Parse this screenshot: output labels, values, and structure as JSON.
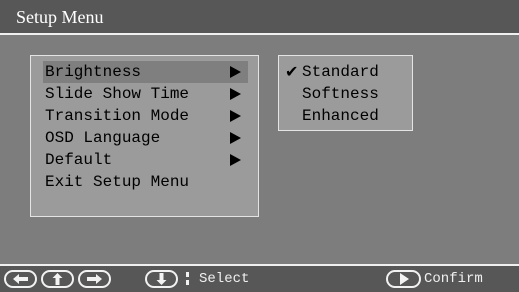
{
  "title": "Setup Menu",
  "menu": {
    "items": [
      {
        "label": "Brightness",
        "has_submenu": true,
        "selected": true
      },
      {
        "label": "Slide Show Time",
        "has_submenu": true,
        "selected": false
      },
      {
        "label": "Transition Mode",
        "has_submenu": true,
        "selected": false
      },
      {
        "label": "OSD Language",
        "has_submenu": true,
        "selected": false
      },
      {
        "label": "Default",
        "has_submenu": true,
        "selected": false
      },
      {
        "label": "Exit Setup Menu",
        "has_submenu": false,
        "selected": false
      }
    ]
  },
  "submenu": {
    "items": [
      {
        "label": "Standard",
        "checked": true
      },
      {
        "label": "Softness",
        "checked": false
      },
      {
        "label": "Enhanced",
        "checked": false
      }
    ]
  },
  "footer": {
    "nav_icons": [
      "left-arrow-icon",
      "up-arrow-icon",
      "right-arrow-icon",
      "down-arrow-icon"
    ],
    "select_label": "Select",
    "confirm_icon": "play-icon",
    "confirm_label": "Confirm"
  },
  "colors": {
    "background": "#7d7d7d",
    "bar": "#575757",
    "panel": "#9b9b9b",
    "highlight": "#7f7f7f",
    "text_light": "#f0f0f0"
  }
}
